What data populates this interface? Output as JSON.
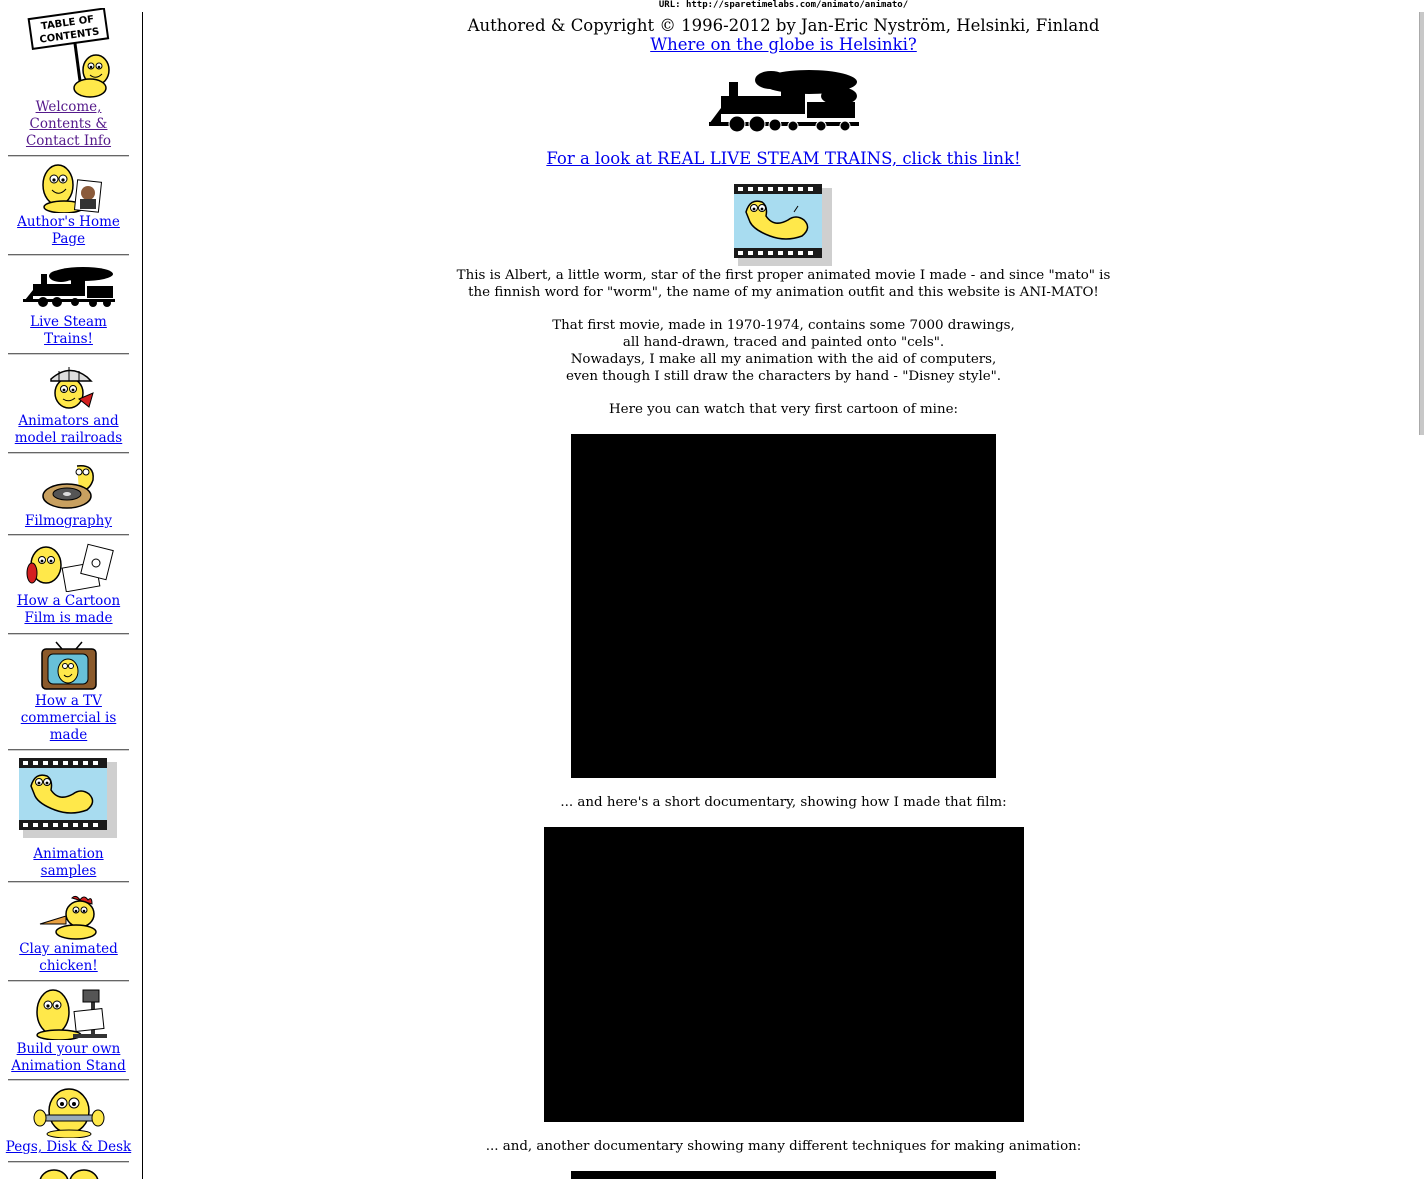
{
  "page": {
    "url_line": "URL: http://sparetimelabs.com/animato/animato/",
    "author_line": "Authored & Copyright © 1996-2012 by Jan-Eric Nyström, Helsinki, Finland",
    "helsinki_link": "Where on the globe is Helsinki?",
    "steam_link": "For a look at REAL LIVE STEAM TRAINS, click this link!",
    "intro": [
      "This is Albert, a little worm, star of the first proper animated movie I made - and since \"mato\" is",
      "the finnish word for \"worm\", the name of my animation outfit and this website is ANI-MATO!"
    ],
    "first_movie": [
      "That first movie, made in 1970-1974, contains some 7000 drawings,",
      "all hand-drawn, traced and painted onto \"cels\".",
      "Nowadays, I make all my animation with the aid of computers,",
      "even though I still draw the characters by hand - \"Disney style\"."
    ],
    "watch_text": "Here you can watch that very first cartoon of mine:",
    "documentary_text": "... and here's a short documentary, showing how I made that film:",
    "techniques_text": "... and, another documentary showing many different techniques for making animation:"
  },
  "sidebar": {
    "items": [
      {
        "lines": [
          "Welcome,",
          "Contents &",
          "Contact Info"
        ],
        "icon": "table-of-contents-worm-icon"
      },
      {
        "lines": [
          "Author's Home",
          "Page"
        ],
        "icon": "worm-with-author-photo-icon"
      },
      {
        "lines": [
          "Live Steam",
          "Trains!"
        ],
        "icon": "steam-locomotive-icon"
      },
      {
        "lines": [
          "Animators and",
          "model railroads"
        ],
        "icon": "engineer-worm-icon"
      },
      {
        "lines": [
          "Filmography"
        ],
        "icon": "film-reel-worm-icon"
      },
      {
        "lines": [
          "How a Cartoon",
          "Film is made"
        ],
        "icon": "drawing-worm-icon"
      },
      {
        "lines": [
          "How a TV",
          "commercial is",
          "made"
        ],
        "icon": "tv-set-icon"
      },
      {
        "lines": [
          "Animation",
          "samples"
        ],
        "icon": "film-frame-worm-icon"
      },
      {
        "lines": [
          "Clay animated",
          "chicken!"
        ],
        "icon": "clay-chicken-icon"
      },
      {
        "lines": [
          "Build your own",
          "Animation Stand"
        ],
        "icon": "animation-stand-worm-icon"
      },
      {
        "lines": [
          "Pegs, Disk & Desk"
        ],
        "icon": "worm-holding-peg-bar-icon"
      }
    ]
  },
  "colors": {
    "link": "#0000ee",
    "visited_link": "#551a8b",
    "worm_yellow": "#ffe84a",
    "film_sky": "#a8dcf0"
  }
}
